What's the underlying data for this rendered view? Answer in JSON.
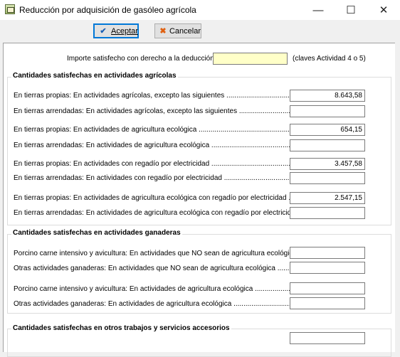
{
  "window": {
    "title": "Reducción por adquisición de gasóleo agrícola",
    "min_icon": "minimize-icon",
    "max_icon": "maximize-icon",
    "close_icon": "close-icon"
  },
  "toolbar": {
    "accept_label": "Aceptar",
    "cancel_label": "Cancelar"
  },
  "header": {
    "label": "Importe satisfecho con derecho a la deducción",
    "value": "",
    "note": "(claves Actividad 4 o 5)"
  },
  "agricolas": {
    "title": "Cantidades satisfechas en actividades agrícolas",
    "rows": [
      {
        "label": "En tierras propias: En actividades agrícolas, excepto las siguientes ......................................",
        "value": "8.643,58"
      },
      {
        "label": "En tierras arrendadas: En actividades agrícolas, excepto las siguientes ..................................",
        "value": ""
      },
      {
        "label": "En tierras propias: En actividades de agricultura ecológica .........................................................",
        "value": "654,15"
      },
      {
        "label": "En tierras arrendadas: En actividades de agricultura ecológica .....................................................",
        "value": ""
      },
      {
        "label": "En tierras propias: En actividades con regadío por electricidad ....................................................",
        "value": "3.457,58"
      },
      {
        "label": "En tierras arrendadas: En actividades con regadío por electricidad ...............................................",
        "value": ""
      },
      {
        "label": "En tierras propias: En actividades de agricultura ecológica con regadío por electricidad ....",
        "value": "2.547,15"
      },
      {
        "label": "En tierras arrendadas: En actividades de agricultura ecológica con regadío por electricidad",
        "value": ""
      }
    ]
  },
  "ganaderas": {
    "title": "Cantidades satisfechas en actividades ganaderas",
    "rows": [
      {
        "label": "Porcino carne intensivo y avicultura: En actividades que NO sean de agricultura ecológica",
        "value": ""
      },
      {
        "label": "Otras actividades ganaderas: En actividades que NO sean de agricultura ecológica ...........",
        "value": ""
      },
      {
        "label": "Porcino carne intensivo y avicultura: En actividades de agricultura ecológica .....................",
        "value": ""
      },
      {
        "label": "Otras actividades ganaderas: En actividades de agricultura ecológica ...............................",
        "value": ""
      }
    ]
  },
  "otros": {
    "title": "Cantidades satisfechas en  otros trabajos y servicios accesorios",
    "value": ""
  }
}
